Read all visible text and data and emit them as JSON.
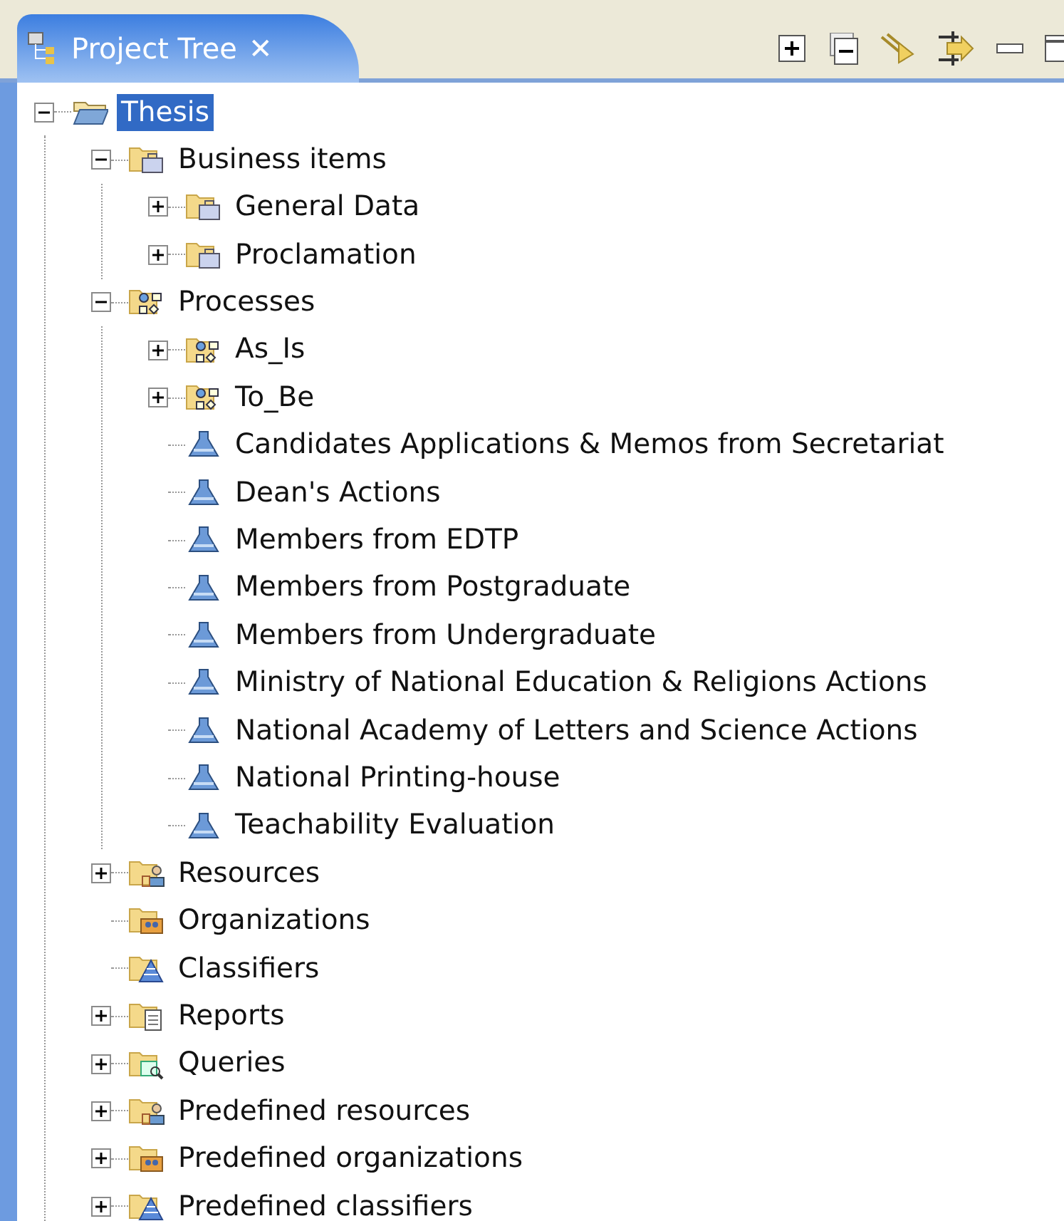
{
  "view": {
    "title": "Project Tree",
    "close": "✕"
  },
  "tree": [
    {
      "label": "Thesis",
      "kind": "folder",
      "selected": true,
      "expanded": true,
      "children": [
        {
          "label": "Business items",
          "kind": "business",
          "selected": false,
          "expanded": true,
          "children": [
            {
              "label": "General Data",
              "kind": "business",
              "selected": false,
              "expanded": false
            },
            {
              "label": "Proclamation",
              "kind": "business",
              "selected": false,
              "expanded": false
            }
          ]
        },
        {
          "label": "Processes",
          "kind": "process",
          "selected": false,
          "expanded": true,
          "children": [
            {
              "label": "As_Is",
              "kind": "process",
              "selected": false,
              "expanded": false
            },
            {
              "label": "To_Be",
              "kind": "process",
              "selected": false,
              "expanded": false
            },
            {
              "label": "Candidates Applications & Memos from Secretariat",
              "kind": "diagram",
              "selected": false
            },
            {
              "label": "Dean's Actions",
              "kind": "diagram",
              "selected": false
            },
            {
              "label": "Members from EDTP",
              "kind": "diagram",
              "selected": false
            },
            {
              "label": "Members from Postgraduate",
              "kind": "diagram",
              "selected": false
            },
            {
              "label": "Members from Undergraduate",
              "kind": "diagram",
              "selected": false
            },
            {
              "label": "Ministry of National Education & Religions Actions",
              "kind": "diagram",
              "selected": false
            },
            {
              "label": "National Academy of Letters and Science Actions",
              "kind": "diagram",
              "selected": false
            },
            {
              "label": "National Printing-house",
              "kind": "diagram",
              "selected": false
            },
            {
              "label": "Teachability Evaluation",
              "kind": "diagram",
              "selected": false
            }
          ]
        },
        {
          "label": "Resources",
          "kind": "resource",
          "selected": false,
          "expanded": false
        },
        {
          "label": "Organizations",
          "kind": "organization",
          "selected": false
        },
        {
          "label": "Classifiers",
          "kind": "classifier",
          "selected": false
        },
        {
          "label": "Reports",
          "kind": "report",
          "selected": false,
          "expanded": false
        },
        {
          "label": "Queries",
          "kind": "query",
          "selected": false,
          "expanded": false
        },
        {
          "label": "Predefined resources",
          "kind": "resource",
          "selected": false,
          "expanded": false
        },
        {
          "label": "Predefined organizations",
          "kind": "organization",
          "selected": false,
          "expanded": false
        },
        {
          "label": "Predefined classifiers",
          "kind": "classifier",
          "selected": false,
          "expanded": false
        }
      ]
    }
  ]
}
